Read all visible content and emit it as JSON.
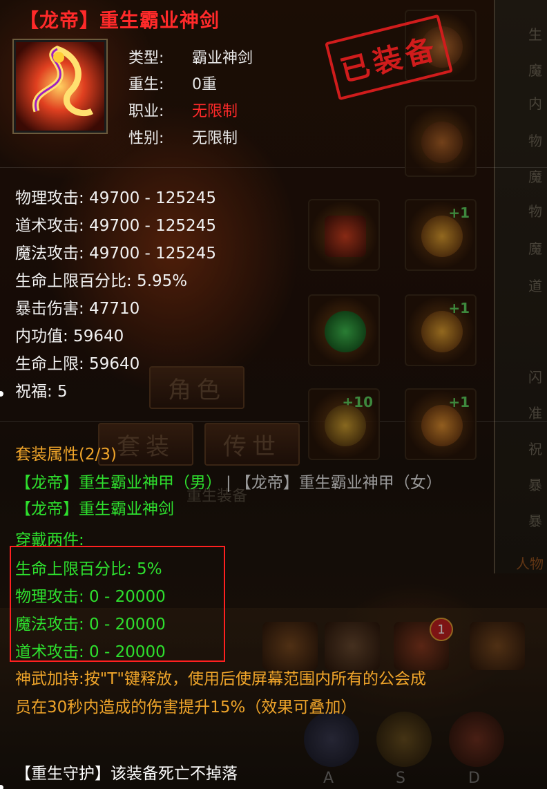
{
  "item": {
    "title": "【龙帝】重生霸业神剑",
    "stamp": "已装备",
    "info": [
      {
        "label": "类型:",
        "value": "霸业神剑",
        "value_color": "#e8e8e8"
      },
      {
        "label": "重生:",
        "value": "0重",
        "value_color": "#e8e8e8"
      },
      {
        "label": "职业:",
        "value": "无限制",
        "value_color": "#ff2a2a"
      },
      {
        "label": "性别:",
        "value": "无限制",
        "value_color": "#e8e8e8"
      }
    ]
  },
  "stats": [
    "物理攻击: 49700 - 125245",
    "道术攻击: 49700 - 125245",
    "魔法攻击: 49700 - 125245",
    "生命上限百分比: 5.95%",
    "暴击伤害: 47710",
    "内功值: 59640",
    "生命上限: 59640",
    "祝福: 5"
  ],
  "set": {
    "title": "套装属性(2/3)",
    "piece1": "【龙帝】重生霸业神甲（男）",
    "separator": "|",
    "piece2": "【龙帝】重生霸业神甲（女）",
    "piece3": "【龙帝】重生霸业神剑",
    "bonus_header": "穿戴两件:",
    "bonuses": [
      "生命上限百分比: 5%",
      "物理攻击: 0 - 20000",
      "魔法攻击: 0 - 20000",
      "道术攻击: 0 - 20000"
    ]
  },
  "description": {
    "line1": "神武加持:按\"T\"键释放，使用后使屏幕范围内所有的公会成",
    "line2": "员在30秒内造成的伤害提升15%（效果可叠加）"
  },
  "footer": "【重生守护】该装备死亡不掉落",
  "background": {
    "buttons": [
      "角色",
      "套装",
      "传世"
    ],
    "right_panel_chars": [
      "生",
      "魔",
      "内",
      "物",
      "魔",
      "物",
      "魔",
      "道",
      "闪",
      "准",
      "祝",
      "暴",
      "暴",
      "人物"
    ],
    "slot_badges": [
      "+1",
      "+1",
      "+10",
      "+1"
    ],
    "hotkeys": [
      "A",
      "S",
      "D"
    ],
    "notification_count": "1",
    "faint_text": "重生装备"
  },
  "colors": {
    "title_red": "#ff2a2a",
    "set_orange": "#f0a52a",
    "set_green": "#2ee02e",
    "highlight_box": "#ff2020"
  }
}
